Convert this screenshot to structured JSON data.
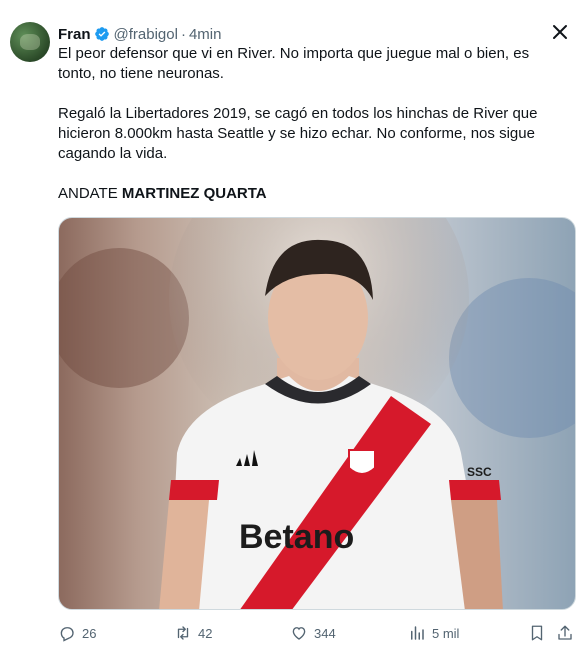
{
  "author": {
    "name": "Fran",
    "handle": "@frabigol",
    "time": "4min"
  },
  "tweet": {
    "paragraph1": "El peor defensor que vi en River. No importa que juegue mal o bien, es tonto, no tiene neuronas.",
    "paragraph2": "Regaló la Libertadores 2019, se cagó en todos los hinchas de River que hicieron 8.000km hasta Seattle y se hizo echar. No conforme, nos sigue cagando la vida.",
    "paragraph3_prefix": "ANDATE ",
    "paragraph3_bold": "MARTINEZ QUARTA"
  },
  "media": {
    "sponsor_text": "Betano",
    "kit_text": "SSC",
    "icon": "river-plate-player-photo"
  },
  "actions": {
    "replies": "26",
    "reposts": "42",
    "likes": "344",
    "views": "5 mil"
  },
  "colors": {
    "verified": "#1d9bf0",
    "muted": "#536471",
    "text": "#0f1419",
    "river_red": "#d6192b"
  }
}
